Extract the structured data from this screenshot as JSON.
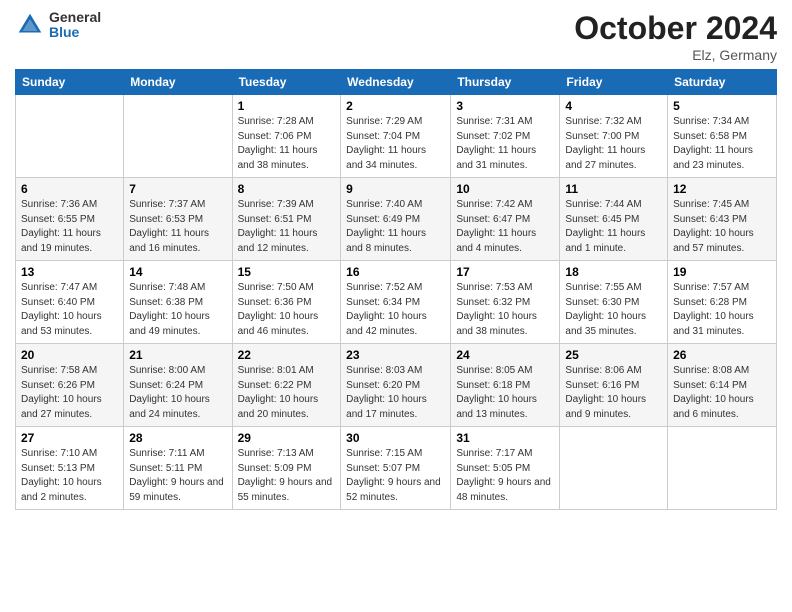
{
  "header": {
    "logo_general": "General",
    "logo_blue": "Blue",
    "month_title": "October 2024",
    "location": "Elz, Germany"
  },
  "weekdays": [
    "Sunday",
    "Monday",
    "Tuesday",
    "Wednesday",
    "Thursday",
    "Friday",
    "Saturday"
  ],
  "weeks": [
    [
      null,
      null,
      {
        "day": 1,
        "sunrise": "7:28 AM",
        "sunset": "7:06 PM",
        "daylight": "11 hours and 38 minutes."
      },
      {
        "day": 2,
        "sunrise": "7:29 AM",
        "sunset": "7:04 PM",
        "daylight": "11 hours and 34 minutes."
      },
      {
        "day": 3,
        "sunrise": "7:31 AM",
        "sunset": "7:02 PM",
        "daylight": "11 hours and 31 minutes."
      },
      {
        "day": 4,
        "sunrise": "7:32 AM",
        "sunset": "7:00 PM",
        "daylight": "11 hours and 27 minutes."
      },
      {
        "day": 5,
        "sunrise": "7:34 AM",
        "sunset": "6:58 PM",
        "daylight": "11 hours and 23 minutes."
      }
    ],
    [
      {
        "day": 6,
        "sunrise": "7:36 AM",
        "sunset": "6:55 PM",
        "daylight": "11 hours and 19 minutes."
      },
      {
        "day": 7,
        "sunrise": "7:37 AM",
        "sunset": "6:53 PM",
        "daylight": "11 hours and 16 minutes."
      },
      {
        "day": 8,
        "sunrise": "7:39 AM",
        "sunset": "6:51 PM",
        "daylight": "11 hours and 12 minutes."
      },
      {
        "day": 9,
        "sunrise": "7:40 AM",
        "sunset": "6:49 PM",
        "daylight": "11 hours and 8 minutes."
      },
      {
        "day": 10,
        "sunrise": "7:42 AM",
        "sunset": "6:47 PM",
        "daylight": "11 hours and 4 minutes."
      },
      {
        "day": 11,
        "sunrise": "7:44 AM",
        "sunset": "6:45 PM",
        "daylight": "11 hours and 1 minute."
      },
      {
        "day": 12,
        "sunrise": "7:45 AM",
        "sunset": "6:43 PM",
        "daylight": "10 hours and 57 minutes."
      }
    ],
    [
      {
        "day": 13,
        "sunrise": "7:47 AM",
        "sunset": "6:40 PM",
        "daylight": "10 hours and 53 minutes."
      },
      {
        "day": 14,
        "sunrise": "7:48 AM",
        "sunset": "6:38 PM",
        "daylight": "10 hours and 49 minutes."
      },
      {
        "day": 15,
        "sunrise": "7:50 AM",
        "sunset": "6:36 PM",
        "daylight": "10 hours and 46 minutes."
      },
      {
        "day": 16,
        "sunrise": "7:52 AM",
        "sunset": "6:34 PM",
        "daylight": "10 hours and 42 minutes."
      },
      {
        "day": 17,
        "sunrise": "7:53 AM",
        "sunset": "6:32 PM",
        "daylight": "10 hours and 38 minutes."
      },
      {
        "day": 18,
        "sunrise": "7:55 AM",
        "sunset": "6:30 PM",
        "daylight": "10 hours and 35 minutes."
      },
      {
        "day": 19,
        "sunrise": "7:57 AM",
        "sunset": "6:28 PM",
        "daylight": "10 hours and 31 minutes."
      }
    ],
    [
      {
        "day": 20,
        "sunrise": "7:58 AM",
        "sunset": "6:26 PM",
        "daylight": "10 hours and 27 minutes."
      },
      {
        "day": 21,
        "sunrise": "8:00 AM",
        "sunset": "6:24 PM",
        "daylight": "10 hours and 24 minutes."
      },
      {
        "day": 22,
        "sunrise": "8:01 AM",
        "sunset": "6:22 PM",
        "daylight": "10 hours and 20 minutes."
      },
      {
        "day": 23,
        "sunrise": "8:03 AM",
        "sunset": "6:20 PM",
        "daylight": "10 hours and 17 minutes."
      },
      {
        "day": 24,
        "sunrise": "8:05 AM",
        "sunset": "6:18 PM",
        "daylight": "10 hours and 13 minutes."
      },
      {
        "day": 25,
        "sunrise": "8:06 AM",
        "sunset": "6:16 PM",
        "daylight": "10 hours and 9 minutes."
      },
      {
        "day": 26,
        "sunrise": "8:08 AM",
        "sunset": "6:14 PM",
        "daylight": "10 hours and 6 minutes."
      }
    ],
    [
      {
        "day": 27,
        "sunrise": "7:10 AM",
        "sunset": "5:13 PM",
        "daylight": "10 hours and 2 minutes."
      },
      {
        "day": 28,
        "sunrise": "7:11 AM",
        "sunset": "5:11 PM",
        "daylight": "9 hours and 59 minutes."
      },
      {
        "day": 29,
        "sunrise": "7:13 AM",
        "sunset": "5:09 PM",
        "daylight": "9 hours and 55 minutes."
      },
      {
        "day": 30,
        "sunrise": "7:15 AM",
        "sunset": "5:07 PM",
        "daylight": "9 hours and 52 minutes."
      },
      {
        "day": 31,
        "sunrise": "7:17 AM",
        "sunset": "5:05 PM",
        "daylight": "9 hours and 48 minutes."
      },
      null,
      null
    ]
  ]
}
